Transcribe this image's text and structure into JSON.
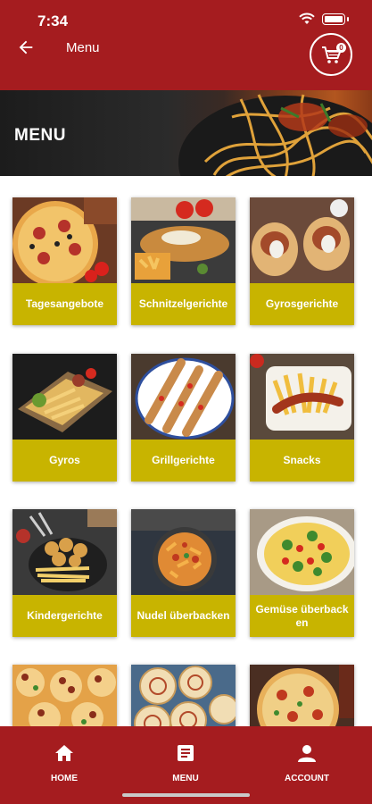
{
  "status_bar": {
    "time": "7:34"
  },
  "header": {
    "title": "Menu",
    "cart_count": "0"
  },
  "banner": {
    "title": "MENU"
  },
  "categories": [
    {
      "label": "Tagesangebote"
    },
    {
      "label": "Schnitzelgerichte"
    },
    {
      "label": "Gyrosgerichte"
    },
    {
      "label": "Gyros"
    },
    {
      "label": "Grillgerichte"
    },
    {
      "label": "Snacks"
    },
    {
      "label": "Kindergerichte"
    },
    {
      "label": "Nudel überbacken"
    },
    {
      "label": "Gemüse überbacken"
    },
    {
      "label": ""
    },
    {
      "label": ""
    },
    {
      "label": ""
    }
  ],
  "bottom_nav": {
    "home": "HOME",
    "menu": "MENU",
    "account": "ACCOUNT"
  },
  "colors": {
    "brand_red": "#a51c1f",
    "label_yellow": "#c8b400"
  }
}
